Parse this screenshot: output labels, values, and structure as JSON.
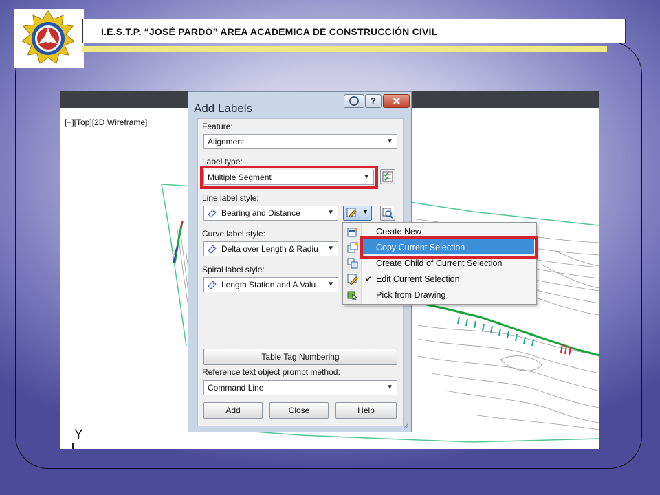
{
  "slide": {
    "header_title": "I.E.S.T.P. “JOSÉ PARDO” AREA ACADEMICA DE CONSTRUCCIÓN CIVIL",
    "logo_icon": "institute-gear-emblem-icon",
    "colors": {
      "yellow_bar": "#efe982",
      "background_edge": "#4b4b9a"
    }
  },
  "cad": {
    "viewport_label": "[−][Top][2D Wireframe]",
    "ucs_axis_label": "Y",
    "colors": {
      "alignment": "#15a63a",
      "contours": "#9a9a9a",
      "surface_boundary": "#4fc890"
    }
  },
  "dialog": {
    "title": "Add Labels",
    "titlebar_buttons": [
      {
        "icon": "help-circle-icon"
      },
      {
        "label": "?",
        "icon": "question-icon"
      },
      {
        "icon": "close-icon"
      }
    ],
    "feature": {
      "label": "Feature:",
      "value": "Alignment"
    },
    "label_type": {
      "label": "Label type:",
      "value": "Multiple Segment"
    },
    "line_label_style": {
      "label": "Line label style:",
      "value": "Bearing and Distance"
    },
    "curve_label_style": {
      "label": "Curve label style:",
      "value": "Delta over Length & Radiu"
    },
    "spiral_label_style": {
      "label": "Spiral label style:",
      "value": "Length Station and A Valu"
    },
    "table_tag_button": "Table Tag Numbering",
    "reference_prompt": {
      "label": "Reference text object prompt method:",
      "value": "Command Line"
    },
    "buttons": {
      "add": "Add",
      "close": "Close",
      "help": "Help"
    },
    "highlight_color": "#d7212e"
  },
  "context_menu": {
    "items": [
      {
        "label": "Create New",
        "icon": "create-new-style-icon"
      },
      {
        "label": "Copy Current Selection",
        "icon": "copy-style-icon",
        "selected": true
      },
      {
        "label": "Create Child of Current Selection",
        "icon": "child-style-icon"
      },
      {
        "label": "Edit Current Selection",
        "icon": "edit-style-icon",
        "checked": true
      },
      {
        "label": "Pick from Drawing",
        "icon": "pick-from-drawing-icon"
      }
    ],
    "check_mark": "✔",
    "selected_color": "#3e8fd9"
  }
}
